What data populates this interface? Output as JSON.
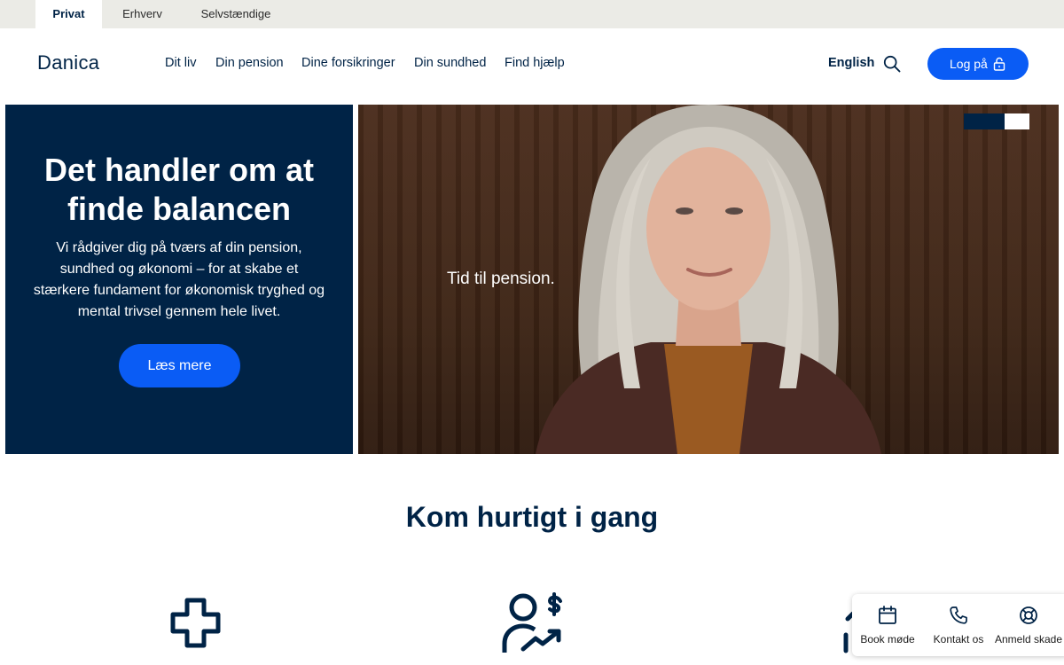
{
  "segments": [
    "Privat",
    "Erhverv",
    "Selvstændige"
  ],
  "header": {
    "logo": "Danica",
    "nav": [
      "Dit liv",
      "Din pension",
      "Dine forsikringer",
      "Din sundhed",
      "Find hjælp"
    ],
    "language": "English",
    "login_label": "Log på"
  },
  "hero": {
    "title": "Det handler om at finde balancen",
    "text": "Vi rådgiver dig på tværs af din pension, sundhed og økonomi – for at skabe et stærkere fundament for økonomisk tryghed og mental trivsel gennem hele livet.",
    "button": "Læs mere",
    "image_caption": "Tid til pension."
  },
  "quick": {
    "title": "Kom hurtigt i gang",
    "icons": [
      "health-cross-icon",
      "person-money-growth-icon",
      "partial-icon"
    ]
  },
  "floating_actions": [
    {
      "label": "Book møde",
      "icon": "calendar-icon"
    },
    {
      "label": "Kontakt os",
      "icon": "phone-icon"
    },
    {
      "label": "Anmeld skade",
      "icon": "lifebuoy-icon"
    }
  ],
  "colors": {
    "navy": "#002346",
    "accent_blue": "#0a5cf5",
    "segment_bar": "#ebebe6"
  }
}
